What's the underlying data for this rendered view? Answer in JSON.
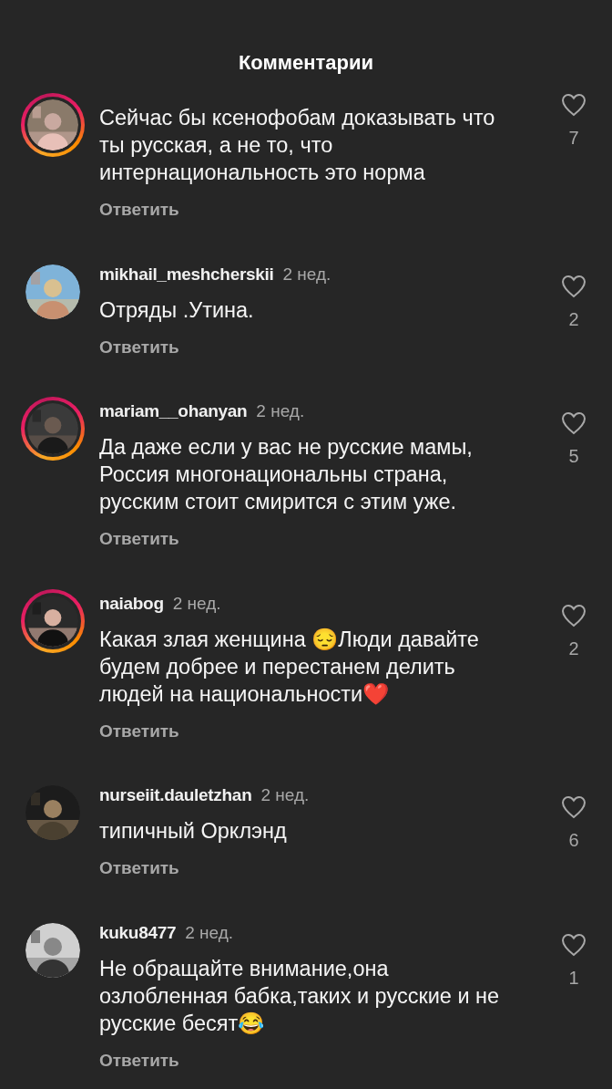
{
  "header": {
    "title": "Комментарии"
  },
  "comments": [
    {
      "story_ring": true,
      "text": "Сейчас бы ксенофобам доказывать что ты русская, а не то, что интернациональность это норма",
      "likes": "7",
      "reply": "Ответить"
    },
    {
      "username": "mikhail_meshcherskii",
      "time": "2 нед.",
      "story_ring": false,
      "text": "Отряды .Утина.",
      "likes": "2",
      "reply": "Ответить"
    },
    {
      "username": "mariam__ohanyan",
      "time": "2 нед.",
      "story_ring": true,
      "text": "Да даже если у вас не русские мамы, Россия многонациональны страна, русским стоит смирится с этим уже.",
      "likes": "5",
      "reply": "Ответить"
    },
    {
      "username": "naiabog",
      "time": "2 нед.",
      "story_ring": true,
      "text": "Какая злая женщина 😔Люди давайте будем добрее и перестанем делить людей на национальности❤️",
      "likes": "2",
      "reply": "Ответить"
    },
    {
      "username": "nurseiit.dauletzhan",
      "time": "2 нед.",
      "story_ring": false,
      "text": "типичный Орклэнд",
      "likes": "6",
      "reply": "Ответить"
    },
    {
      "username": "kuku8477",
      "time": "2 нед.",
      "story_ring": false,
      "text": "Не обращайте внимание,она озлобленная бабка,таких и русские и не русские бесят😂",
      "likes": "1",
      "reply": "Ответить"
    }
  ]
}
